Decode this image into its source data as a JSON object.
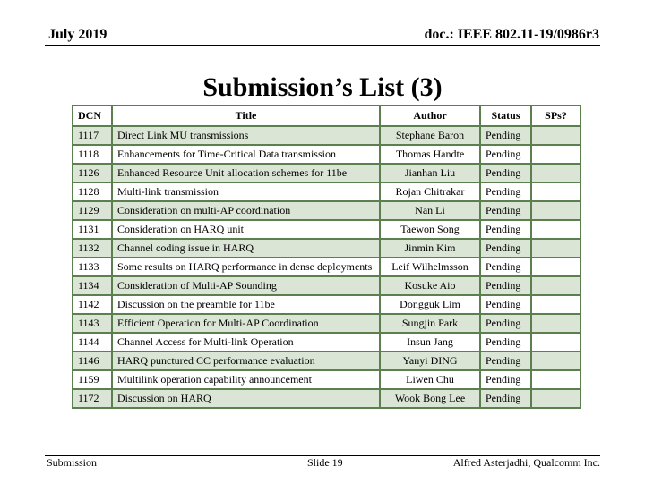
{
  "header": {
    "date": "July 2019",
    "doc_id": "doc.: IEEE 802.11-19/0986r3"
  },
  "slide_title": "Submission’s List (3)",
  "table": {
    "columns": [
      "DCN",
      "Title",
      "Author",
      "Status",
      "SPs?"
    ],
    "rows": [
      {
        "dcn": "1117",
        "title": "Direct Link MU transmissions",
        "author": "Stephane Baron",
        "status": "Pending",
        "sps": ""
      },
      {
        "dcn": "1118",
        "title": "Enhancements for Time-Critical Data transmission",
        "author": "Thomas Handte",
        "status": "Pending",
        "sps": ""
      },
      {
        "dcn": "1126",
        "title": "Enhanced Resource Unit allocation schemes for 11be",
        "author": "Jianhan Liu",
        "status": "Pending",
        "sps": ""
      },
      {
        "dcn": "1128",
        "title": " Multi-link transmission",
        "author": "Rojan Chitrakar",
        "status": "Pending",
        "sps": ""
      },
      {
        "dcn": "1129",
        "title": "Consideration on multi-AP coordination",
        "author": "Nan Li",
        "status": "Pending",
        "sps": ""
      },
      {
        "dcn": "1131",
        "title": "Consideration on HARQ unit",
        "author": "Taewon Song",
        "status": "Pending",
        "sps": ""
      },
      {
        "dcn": "1132",
        "title": "Channel coding issue in HARQ",
        "author": "Jinmin Kim",
        "status": "Pending",
        "sps": ""
      },
      {
        "dcn": "1133",
        "title": "Some results on HARQ performance in dense deployments",
        "author": "Leif Wilhelmsson",
        "status": "Pending",
        "sps": ""
      },
      {
        "dcn": "1134",
        "title": "Consideration of Multi-AP Sounding",
        "author": "Kosuke Aio",
        "status": "Pending",
        "sps": ""
      },
      {
        "dcn": "1142",
        "title": "Discussion on the preamble for 11be",
        "author": "Dongguk Lim",
        "status": "Pending",
        "sps": ""
      },
      {
        "dcn": "1143",
        "title": "Efficient Operation for Multi-AP Coordination",
        "author": "Sungjin Park",
        "status": "Pending",
        "sps": ""
      },
      {
        "dcn": "1144",
        "title": "Channel Access for Multi-link Operation",
        "author": "Insun Jang",
        "status": "Pending",
        "sps": ""
      },
      {
        "dcn": "1146",
        "title": "HARQ punctured CC performance evaluation",
        "author": "Yanyi DING",
        "status": "Pending",
        "sps": ""
      },
      {
        "dcn": "1159",
        "title": "Multilink operation capability announcement",
        "author": "Liwen Chu",
        "status": "Pending",
        "sps": ""
      },
      {
        "dcn": "1172",
        "title": "Discussion on HARQ",
        "author": "Wook Bong Lee",
        "status": "Pending",
        "sps": ""
      }
    ]
  },
  "footer": {
    "left": "Submission",
    "center": "Slide 19",
    "right": "Alfred Asterjadhi, Qualcomm Inc."
  },
  "colors": {
    "table_border": "#5b7f4e",
    "row_shade": "#dbe5d6"
  }
}
